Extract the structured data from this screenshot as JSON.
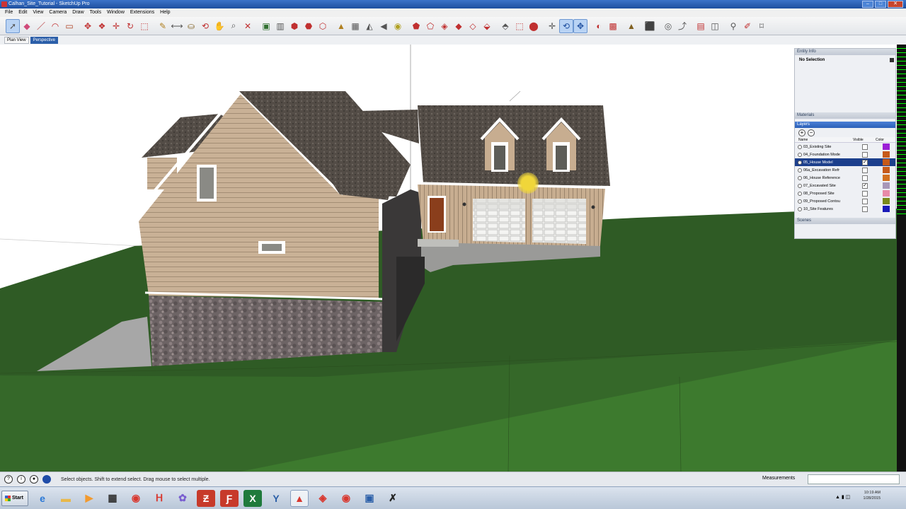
{
  "window": {
    "title": "Calhan_Site_Tutorial - SketchUp Pro"
  },
  "menus": [
    "File",
    "Edit",
    "View",
    "Camera",
    "Draw",
    "Tools",
    "Window",
    "Extensions",
    "Help"
  ],
  "view_tabs": [
    {
      "label": "Plan View",
      "active": false
    },
    {
      "label": "Perspective",
      "active": true
    }
  ],
  "toolbar": {
    "active_tools": [
      "select-tool",
      "orbit-tool",
      "pan-tool"
    ]
  },
  "entity_info": {
    "title": "Entity Info",
    "value": "No Selection"
  },
  "materials": {
    "title": "Materials"
  },
  "layers": {
    "title": "Layers",
    "columns": {
      "name": "Name",
      "visible": "Visible",
      "color": "Color"
    },
    "rows": [
      {
        "name": "03_Existing Site",
        "visible": false,
        "color": "#9b1fd6",
        "selected": false
      },
      {
        "name": "04_Foundation Mode",
        "visible": false,
        "color": "#c65a1a",
        "selected": false
      },
      {
        "name": "05_House Model",
        "visible": true,
        "color": "#c65a1a",
        "selected": true
      },
      {
        "name": "06a_Excavation Refr",
        "visible": false,
        "color": "#c65a1a",
        "selected": false
      },
      {
        "name": "06_House Reference",
        "visible": false,
        "color": "#d2701f",
        "selected": false
      },
      {
        "name": "07_Excavated Site",
        "visible": true,
        "color": "#a897b8",
        "selected": false
      },
      {
        "name": "08_Proposed Site",
        "visible": false,
        "color": "#e88aa8",
        "selected": false
      },
      {
        "name": "09_Proposed Contou",
        "visible": false,
        "color": "#7a8a1a",
        "selected": false
      },
      {
        "name": "10_Site Features",
        "visible": false,
        "color": "#1a1ab8",
        "selected": false
      }
    ]
  },
  "scenes": {
    "title": "Scenes"
  },
  "status": {
    "message": "Select objects. Shift to extend select. Drag mouse to select multiple.",
    "measurements_label": "Measurements",
    "measurements_value": ""
  },
  "taskbar": {
    "start_label": "Start",
    "apps": [
      "ie-icon",
      "explorer-icon",
      "media-icon",
      "grid-app-icon",
      "chrome-icon",
      "app-icon",
      "app-icon-2",
      "filezilla-icon",
      "filezilla-icon-2",
      "excel-icon",
      "app-icon-3",
      "sketchup-icon",
      "app-icon-4",
      "app-icon-5",
      "app-icon-6",
      "sketchup-icon-2"
    ],
    "clock_time": "10:19 AM",
    "clock_date": "1/28/2015"
  },
  "colors": {
    "accent": "#2c5fa9",
    "grass": "#2e5a24",
    "siding": "#c9b196"
  }
}
